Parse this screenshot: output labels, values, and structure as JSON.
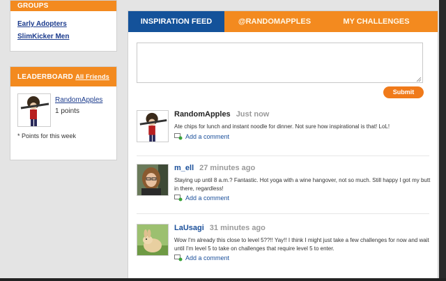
{
  "groups": {
    "title": "GROUPS",
    "items": [
      "Early Adopters",
      "SlimKicker Men"
    ]
  },
  "leaderboard": {
    "title": "LEADERBOARD",
    "all_friends_label": "All Friends",
    "entry": {
      "name": "RandomApples",
      "points": "1 points"
    },
    "note": "* Points for this week"
  },
  "tabs": [
    {
      "label": "INSPIRATION FEED",
      "active": true
    },
    {
      "label": "@RANDOMAPPLES",
      "active": false
    },
    {
      "label": "MY CHALLENGES",
      "active": false
    }
  ],
  "composer": {
    "value": "",
    "submit_label": "Submit"
  },
  "feed": [
    {
      "name": "RandomApples",
      "time": "Just now",
      "text": "Ate chips for lunch and instant noodle for dinner. Not sure how inspirational is that! LoL!",
      "comment_label": "Add a comment"
    },
    {
      "name": "m_ell",
      "time": "27 minutes ago",
      "text": "Staying up until 8 a.m.? Fantastic. Hot yoga with a wine hangover, not so much. Still happy I got my butt in there, regardless!",
      "comment_label": "Add a comment"
    },
    {
      "name": "LaUsagi",
      "time": "31 minutes ago",
      "text": "Wow I'm already this close to level 5??!! Yay!! I think I might just take a few challenges for now and wait until I'm level 5 to take on challenges that require level 5 to enter.",
      "comment_label": "Add a comment"
    }
  ],
  "colors": {
    "accent": "#f38a1f",
    "active_tab": "#14529a",
    "link": "#1a3a8c"
  }
}
